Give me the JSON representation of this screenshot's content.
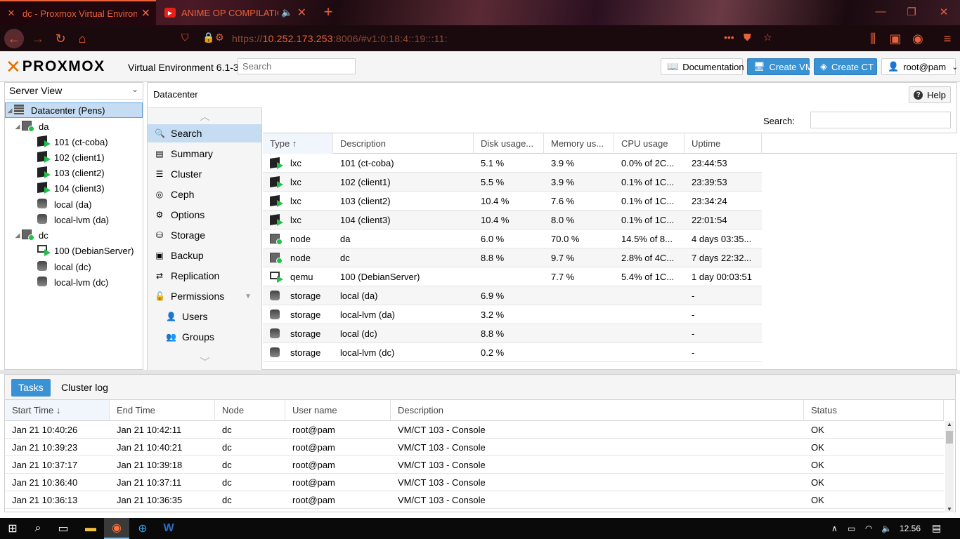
{
  "browser": {
    "tabs": [
      {
        "title": "dc - Proxmox Virtual Environment",
        "active": true
      },
      {
        "title": "ANIME OP COMPILATION!!",
        "active": false
      }
    ],
    "url_prefix": "https://",
    "url_host": "10.252.173.253",
    "url_rest": ":8006/#v1:0:18:4::19:::11:"
  },
  "header": {
    "logo_text": "PROXMOX",
    "version": "Virtual Environment 6.1-3",
    "search_placeholder": "Search",
    "documentation": "Documentation",
    "create_vm": "Create VM",
    "create_ct": "Create CT",
    "user": "root@pam"
  },
  "tree": {
    "view": "Server View",
    "items": [
      {
        "label": "Datacenter (Pens)",
        "icon": "datacenter-icon"
      },
      {
        "label": "da",
        "icon": "node-icon"
      },
      {
        "label": "101 (ct-coba)",
        "icon": "container-icon"
      },
      {
        "label": "102 (client1)",
        "icon": "container-icon"
      },
      {
        "label": "103 (client2)",
        "icon": "container-icon"
      },
      {
        "label": "104 (client3)",
        "icon": "container-icon"
      },
      {
        "label": "local (da)",
        "icon": "storage-icon"
      },
      {
        "label": "local-lvm (da)",
        "icon": "storage-icon"
      },
      {
        "label": "dc",
        "icon": "node-icon"
      },
      {
        "label": "100 (DebianServer)",
        "icon": "vm-icon"
      },
      {
        "label": "local (dc)",
        "icon": "storage-icon"
      },
      {
        "label": "local-lvm (dc)",
        "icon": "storage-icon"
      }
    ]
  },
  "center": {
    "breadcrumb": "Datacenter",
    "help": "Help",
    "search_label": "Search:",
    "menu": [
      {
        "label": "Search",
        "icon": "search-icon"
      },
      {
        "label": "Summary",
        "icon": "book-icon"
      },
      {
        "label": "Cluster",
        "icon": "server-icon"
      },
      {
        "label": "Ceph",
        "icon": "ceph-icon"
      },
      {
        "label": "Options",
        "icon": "gear-icon"
      },
      {
        "label": "Storage",
        "icon": "database-icon"
      },
      {
        "label": "Backup",
        "icon": "floppy-icon"
      },
      {
        "label": "Replication",
        "icon": "retweet-icon"
      },
      {
        "label": "Permissions",
        "icon": "unlock-icon"
      },
      {
        "label": "Users",
        "icon": "user-icon"
      },
      {
        "label": "Groups",
        "icon": "users-icon"
      }
    ],
    "columns": [
      "Type ↑",
      "Description",
      "Disk usage...",
      "Memory us...",
      "CPU usage",
      "Uptime"
    ],
    "rows": [
      {
        "type": "lxc",
        "desc": "101 (ct-coba)",
        "disk": "5.1 %",
        "mem": "3.9 %",
        "cpu": "0.0% of 2C...",
        "uptime": "23:44:53"
      },
      {
        "type": "lxc",
        "desc": "102 (client1)",
        "disk": "5.5 %",
        "mem": "3.9 %",
        "cpu": "0.1% of 1C...",
        "uptime": "23:39:53"
      },
      {
        "type": "lxc",
        "desc": "103 (client2)",
        "disk": "10.4 %",
        "mem": "7.6 %",
        "cpu": "0.1% of 1C...",
        "uptime": "23:34:24"
      },
      {
        "type": "lxc",
        "desc": "104 (client3)",
        "disk": "10.4 %",
        "mem": "8.0 %",
        "cpu": "0.1% of 1C...",
        "uptime": "22:01:54"
      },
      {
        "type": "node",
        "desc": "da",
        "disk": "6.0 %",
        "mem": "70.0 %",
        "cpu": "14.5% of 8...",
        "uptime": "4 days 03:35..."
      },
      {
        "type": "node",
        "desc": "dc",
        "disk": "8.8 %",
        "mem": "9.7 %",
        "cpu": "2.8% of 4C...",
        "uptime": "7 days 22:32..."
      },
      {
        "type": "qemu",
        "desc": "100 (DebianServer)",
        "disk": "",
        "mem": "7.7 %",
        "cpu": "5.4% of 1C...",
        "uptime": "1 day 00:03:51"
      },
      {
        "type": "storage",
        "desc": "local (da)",
        "disk": "6.9 %",
        "mem": "",
        "cpu": "",
        "uptime": "-"
      },
      {
        "type": "storage",
        "desc": "local-lvm (da)",
        "disk": "3.2 %",
        "mem": "",
        "cpu": "",
        "uptime": "-"
      },
      {
        "type": "storage",
        "desc": "local (dc)",
        "disk": "8.8 %",
        "mem": "",
        "cpu": "",
        "uptime": "-"
      },
      {
        "type": "storage",
        "desc": "local-lvm (dc)",
        "disk": "0.2 %",
        "mem": "",
        "cpu": "",
        "uptime": "-"
      }
    ]
  },
  "bottom": {
    "tabs": [
      "Tasks",
      "Cluster log"
    ],
    "columns": [
      "Start Time ↓",
      "End Time",
      "Node",
      "User name",
      "Description",
      "Status"
    ],
    "rows": [
      [
        "Jan 21 10:40:26",
        "Jan 21 10:42:11",
        "dc",
        "root@pam",
        "VM/CT 103 - Console",
        "OK"
      ],
      [
        "Jan 21 10:39:23",
        "Jan 21 10:40:21",
        "dc",
        "root@pam",
        "VM/CT 103 - Console",
        "OK"
      ],
      [
        "Jan 21 10:37:17",
        "Jan 21 10:39:18",
        "dc",
        "root@pam",
        "VM/CT 103 - Console",
        "OK"
      ],
      [
        "Jan 21 10:36:40",
        "Jan 21 10:37:11",
        "dc",
        "root@pam",
        "VM/CT 103 - Console",
        "OK"
      ],
      [
        "Jan 21 10:36:13",
        "Jan 21 10:36:35",
        "dc",
        "root@pam",
        "VM/CT 103 - Console",
        "OK"
      ]
    ]
  },
  "taskbar": {
    "clock": "12.56"
  },
  "colors": {
    "accent_blue": "#3892d4",
    "selection": "#c5dcf2",
    "running_green": "#21bf4b",
    "proxmox_orange": "#e57000",
    "browser_accent": "#e8623b"
  }
}
